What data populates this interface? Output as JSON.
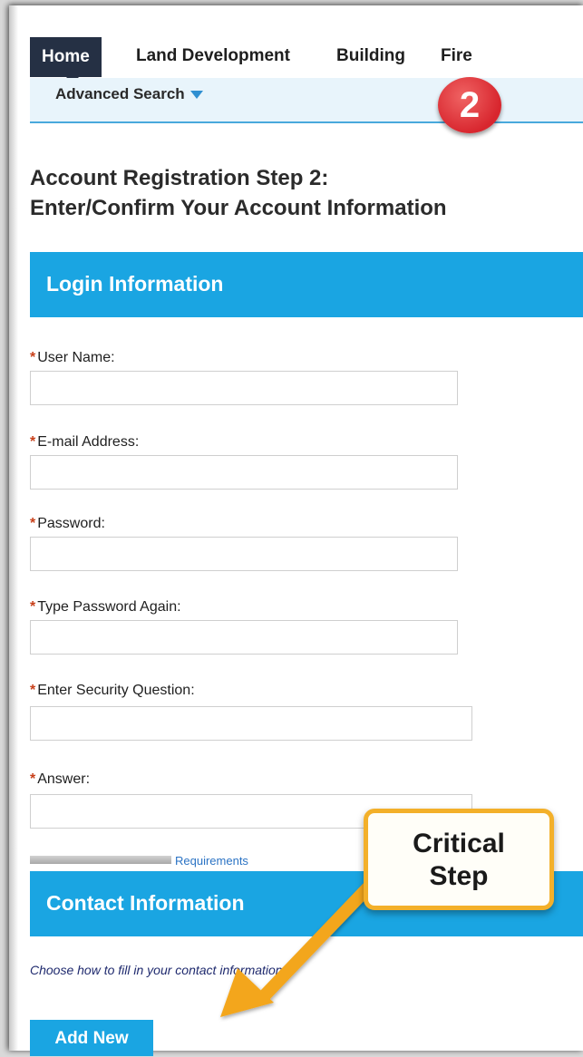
{
  "nav": {
    "tabs": [
      {
        "label": "Home",
        "active": true
      },
      {
        "label": "Land Development",
        "active": false
      },
      {
        "label": "Building",
        "active": false
      },
      {
        "label": "Fire",
        "active": false
      }
    ],
    "sub": {
      "label": "Advanced Search",
      "icon": "caret-down-icon"
    }
  },
  "step_badge": {
    "label": "2",
    "color": "#d8262e"
  },
  "page": {
    "title_line1": "Account Registration Step 2:",
    "title_line2": "Enter/Confirm Your Account Information"
  },
  "login_section": {
    "title": "Login Information",
    "fields": [
      {
        "label": "User Name:",
        "value": "",
        "required": true
      },
      {
        "label": "E-mail Address:",
        "value": "",
        "required": true
      },
      {
        "label": "Password:",
        "value": "",
        "required": true
      },
      {
        "label": "Type Password Again:",
        "value": "",
        "required": true
      },
      {
        "label": "Enter Security Question:",
        "value": "",
        "required": true
      },
      {
        "label": "Answer:",
        "value": "",
        "required": true
      }
    ],
    "requirements_link": "Requirements"
  },
  "contact_section": {
    "title": "Contact Information",
    "note": "Choose how to fill in your contact information.",
    "add_button": "Add New"
  },
  "callout": {
    "line1": "Critical",
    "line2": "Step",
    "border_color": "#f3b02a"
  },
  "colors": {
    "accent": "#1aa5e2",
    "nav_active": "#253044",
    "required": "#c8401a"
  }
}
